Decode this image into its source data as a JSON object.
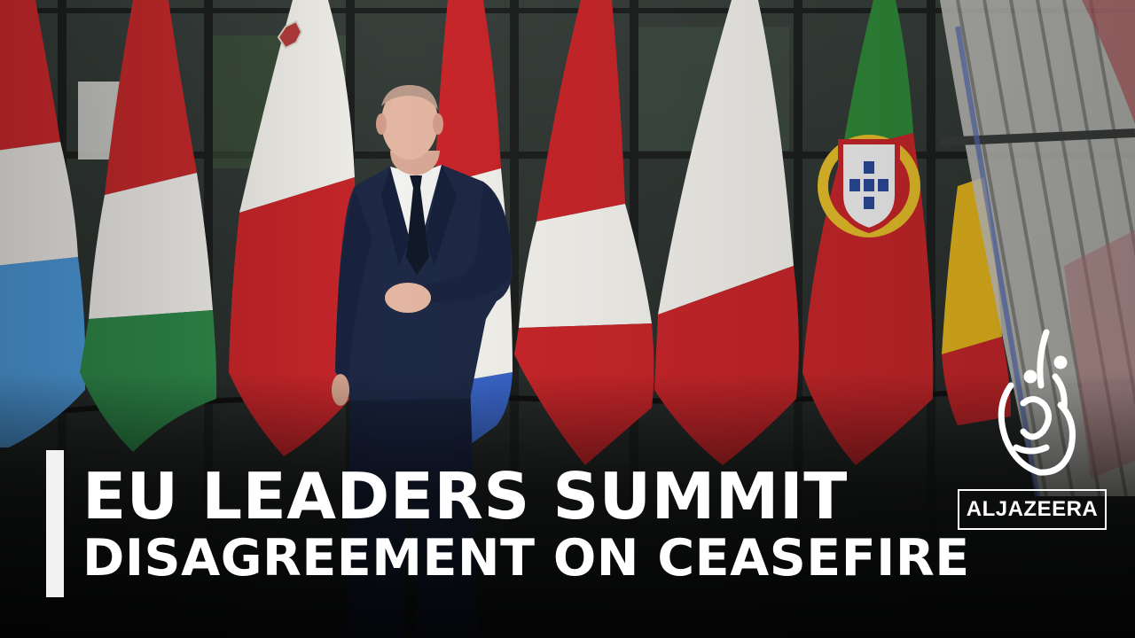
{
  "headline": {
    "line1": "EU LEADERS SUMMIT",
    "line2": "DISAGREEMENT ON CEASEFIRE"
  },
  "broadcaster": {
    "wordmark": "ALJAZEERA",
    "logo_icon": "al-jazeera-calligraphy-icon"
  },
  "colors": {
    "headline_text": "#ffffff",
    "accent_bar": "#f2f2f2",
    "suit": "#1c2640",
    "flag_red": "#c8262a",
    "flag_white": "#f2f0ea",
    "flag_green": "#2f8a4a",
    "flag_blue": "#3f8fd4"
  }
}
